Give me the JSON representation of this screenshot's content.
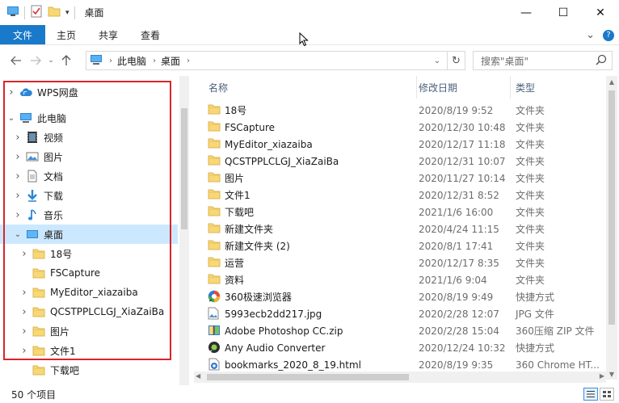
{
  "window": {
    "title": "桌面",
    "minimize_glyph": "—",
    "maximize_glyph": "☐",
    "close_glyph": "✕"
  },
  "ribbon": {
    "tabs": [
      "文件",
      "主页",
      "共享",
      "查看"
    ],
    "expand_glyph": "⌄",
    "help_glyph": "?"
  },
  "address": {
    "crumbs": [
      "此电脑",
      "桌面"
    ],
    "search_placeholder": "搜索\"桌面\""
  },
  "nav": {
    "items": [
      {
        "label": "WPS网盘",
        "icon": "cloud-icon",
        "expanded": false
      },
      {
        "label": "此电脑",
        "icon": "computer-icon",
        "expanded": true
      },
      {
        "label": "视频",
        "icon": "video-folder-icon",
        "expanded": false
      },
      {
        "label": "图片",
        "icon": "pictures-folder-icon",
        "expanded": false
      },
      {
        "label": "文档",
        "icon": "documents-folder-icon",
        "expanded": false
      },
      {
        "label": "下载",
        "icon": "downloads-folder-icon",
        "expanded": false
      },
      {
        "label": "音乐",
        "icon": "music-folder-icon",
        "expanded": false
      },
      {
        "label": "桌面",
        "icon": "desktop-folder-icon",
        "expanded": true,
        "selected": true
      },
      {
        "label": "18号",
        "icon": "folder-icon",
        "expanded": false
      },
      {
        "label": "FSCapture",
        "icon": "folder-icon",
        "expanded": null
      },
      {
        "label": "MyEditor_xiazaiba",
        "icon": "folder-icon",
        "expanded": false
      },
      {
        "label": "QCSTPPLCLGJ_XiaZaiBa",
        "icon": "folder-icon",
        "expanded": false
      },
      {
        "label": "图片",
        "icon": "folder-icon",
        "expanded": false
      },
      {
        "label": "文件1",
        "icon": "folder-icon",
        "expanded": false
      },
      {
        "label": "下载吧",
        "icon": "folder-icon",
        "expanded": null
      }
    ]
  },
  "files": {
    "columns": {
      "name": "名称",
      "date": "修改日期",
      "type": "类型"
    },
    "rows": [
      {
        "name": "18号",
        "date": "2020/8/19 9:52",
        "type": "文件夹",
        "icon": "folder-icon"
      },
      {
        "name": "FSCapture",
        "date": "2020/12/30 10:48",
        "type": "文件夹",
        "icon": "folder-icon"
      },
      {
        "name": "MyEditor_xiazaiba",
        "date": "2020/12/17 11:18",
        "type": "文件夹",
        "icon": "folder-icon"
      },
      {
        "name": "QCSTPPLCLGJ_XiaZaiBa",
        "date": "2020/12/31 10:07",
        "type": "文件夹",
        "icon": "folder-icon"
      },
      {
        "name": "图片",
        "date": "2020/11/27 10:14",
        "type": "文件夹",
        "icon": "folder-icon"
      },
      {
        "name": "文件1",
        "date": "2020/12/31 8:52",
        "type": "文件夹",
        "icon": "folder-icon"
      },
      {
        "name": "下载吧",
        "date": "2021/1/6 16:00",
        "type": "文件夹",
        "icon": "folder-icon"
      },
      {
        "name": "新建文件夹",
        "date": "2020/4/24 11:15",
        "type": "文件夹",
        "icon": "folder-icon"
      },
      {
        "name": "新建文件夹 (2)",
        "date": "2020/8/1 17:41",
        "type": "文件夹",
        "icon": "folder-icon"
      },
      {
        "name": "运营",
        "date": "2020/12/17 8:35",
        "type": "文件夹",
        "icon": "folder-icon"
      },
      {
        "name": "资料",
        "date": "2021/1/6 9:04",
        "type": "文件夹",
        "icon": "folder-icon"
      },
      {
        "name": "360极速浏览器",
        "date": "2020/8/19 9:49",
        "type": "快捷方式",
        "icon": "browser-shortcut-icon"
      },
      {
        "name": "5993ecb2dd217.jpg",
        "date": "2020/2/28 12:07",
        "type": "JPG 文件",
        "icon": "image-file-icon"
      },
      {
        "name": "Adobe Photoshop CC.zip",
        "date": "2020/2/28 15:04",
        "type": "360压缩 ZIP 文件",
        "icon": "zip-file-icon"
      },
      {
        "name": "Any Audio Converter",
        "date": "2020/12/24 10:32",
        "type": "快捷方式",
        "icon": "app-shortcut-icon"
      },
      {
        "name": "bookmarks_2020_8_19.html",
        "date": "2020/8/19 9:35",
        "type": "360 Chrome HT...",
        "icon": "html-file-icon"
      }
    ]
  },
  "status": {
    "item_count": "50 个项目"
  },
  "colors": {
    "accent": "#1979ca",
    "selection": "#cce8ff",
    "highlight_box": "#d9252b",
    "folder": "#f8d775"
  }
}
